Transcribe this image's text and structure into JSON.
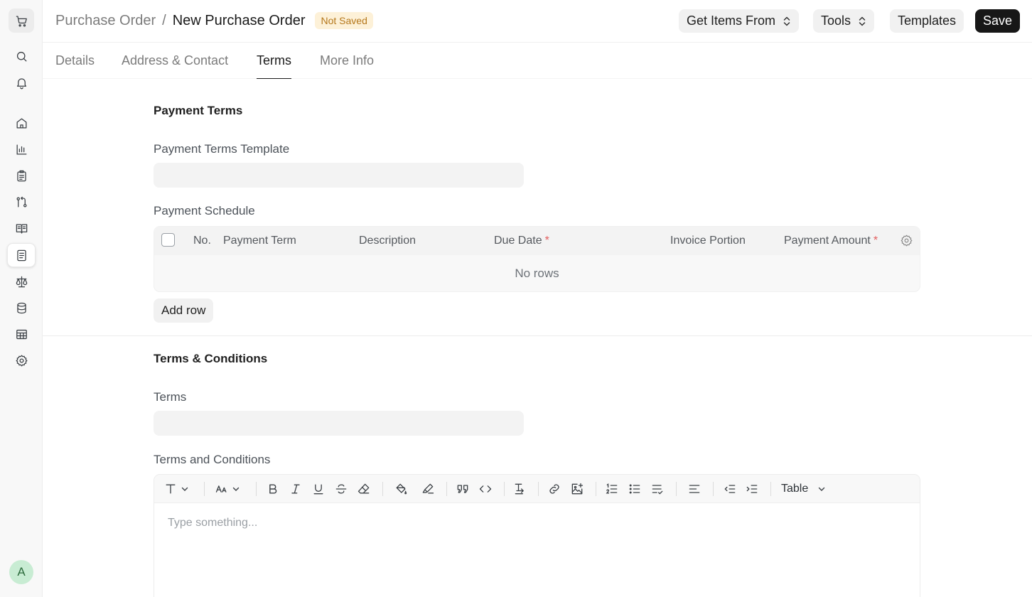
{
  "header": {
    "breadcrumb_parent": "Purchase Order",
    "breadcrumb_separator": "/",
    "title": "New Purchase Order",
    "status_badge": "Not Saved",
    "buttons": {
      "get_items": "Get Items From",
      "tools": "Tools",
      "templates": "Templates",
      "save": "Save"
    }
  },
  "tabs": [
    "Details",
    "Address & Contact",
    "Terms",
    "More Info"
  ],
  "active_tab": "Terms",
  "payment_terms": {
    "section_title": "Payment Terms",
    "template_label": "Payment Terms Template",
    "template_value": "",
    "schedule_label": "Payment Schedule",
    "columns": {
      "no": "No.",
      "payment_term": "Payment Term",
      "description": "Description",
      "due_date": "Due Date",
      "invoice_portion": "Invoice Portion",
      "payment_amount": "Payment Amount"
    },
    "required_marker": "*",
    "empty_text": "No rows",
    "add_row": "Add row"
  },
  "terms_conditions": {
    "section_title": "Terms & Conditions",
    "terms_label": "Terms",
    "terms_value": "",
    "editor_label": "Terms and Conditions",
    "editor_placeholder": "Type something...",
    "table_button": "Table"
  },
  "user": {
    "avatar_initial": "A"
  },
  "colors": {
    "accent": "#171717",
    "badge_bg": "#fdf1d8",
    "badge_text": "#b5781c",
    "required": "#e35d5d"
  },
  "icons": [
    "cart-icon",
    "search-icon",
    "bell-icon",
    "home-icon",
    "chart-icon",
    "clipboard-icon",
    "git-compare-icon",
    "book-icon",
    "document-icon",
    "scale-icon",
    "database-icon",
    "table-icon",
    "settings-icon"
  ]
}
